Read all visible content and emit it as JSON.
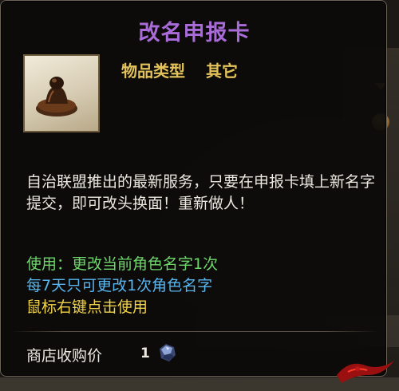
{
  "tooltip": {
    "title": "改名申报卡",
    "item_type_label": "物品类型",
    "item_type_value": "其它",
    "description": "自治联盟推出的最新服务，只要在申报卡填上新名字提交，即可改头换面！重新做人！",
    "usage_text": "使用：更改当前角色名字1次",
    "cooldown_text": "每7天只可更改1次角色名字",
    "hint_text": "鼠标右键点击使用",
    "shop_price_label": "商店收购价",
    "shop_price_value": "1",
    "icons": {
      "item": "stamp-seal-icon",
      "currency": "silver-ore-coin-icon"
    }
  },
  "colors": {
    "title": "#a86bd8",
    "item_type": "#e3c25a",
    "usage": "#6fd66c",
    "cooldown": "#58b5ee",
    "hint": "#f0d24a"
  }
}
